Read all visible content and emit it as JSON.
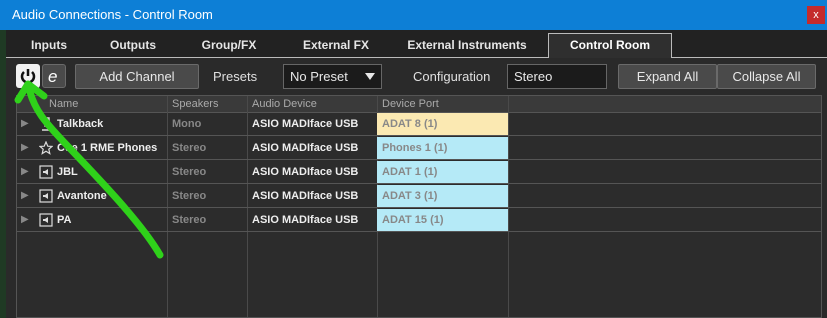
{
  "window": {
    "title": "Audio Connections - Control Room",
    "close_glyph": "x"
  },
  "tabs": [
    {
      "label": "Inputs"
    },
    {
      "label": "Outputs"
    },
    {
      "label": "Group/FX"
    },
    {
      "label": "External FX"
    },
    {
      "label": "External Instruments"
    },
    {
      "label": "Control Room"
    }
  ],
  "active_tab": "Control Room",
  "toolbar": {
    "power_icon": "power-icon",
    "edit_icon": "e-icon",
    "add_channel": "Add Channel",
    "presets_label": "Presets",
    "preset_value": "No Preset",
    "configuration_label": "Configuration",
    "configuration_value": "Stereo",
    "expand_all": "Expand All",
    "collapse_all": "Collapse All"
  },
  "table": {
    "columns": [
      "Name",
      "Speakers",
      "Audio Device",
      "Device Port"
    ],
    "rows": [
      {
        "name": "Talkback",
        "speakers": "Mono",
        "device": "ASIO MADIface USB",
        "port": "ADAT 8 (1)",
        "icon": "talkback-icon",
        "port_color": "#fbe9b2"
      },
      {
        "name": "Cue 1 RME Phones",
        "speakers": "Stereo",
        "device": "ASIO MADIface USB",
        "port": "Phones 1 (1)",
        "icon": "star-icon",
        "port_color": "#b5eaf7"
      },
      {
        "name": "JBL",
        "speakers": "Stereo",
        "device": "ASIO MADIface USB",
        "port": "ADAT 1 (1)",
        "icon": "speaker-icon",
        "port_color": "#b5eaf7"
      },
      {
        "name": "Avantone",
        "speakers": "Stereo",
        "device": "ASIO MADIface USB",
        "port": "ADAT 3 (1)",
        "icon": "speaker-icon",
        "port_color": "#b5eaf7"
      },
      {
        "name": "PA",
        "speakers": "Stereo",
        "device": "ASIO MADIface USB",
        "port": "ADAT 15 (1)",
        "icon": "speaker-icon",
        "port_color": "#b5eaf7"
      }
    ]
  },
  "colors": {
    "titlebar": "#0d7fd6",
    "annotation_arrow": "#2fd11a"
  }
}
